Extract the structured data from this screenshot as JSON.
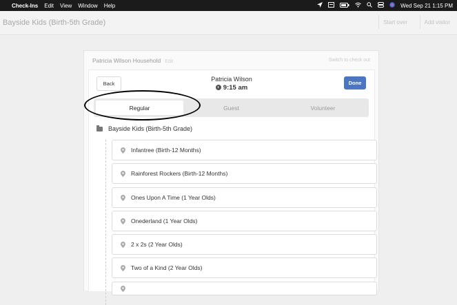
{
  "menubar": {
    "apple_icon": "apple-icon",
    "app_name": "Check-Ins",
    "menus": [
      "Edit",
      "View",
      "Window",
      "Help"
    ],
    "clock": "Wed Sep 21  1:15 PM"
  },
  "header": {
    "title": "Bayside Kids (Birth-5th Grade)",
    "start_over": "Start over",
    "add_visitor": "Add visitor"
  },
  "household": {
    "name": "Patricia Wilson Household",
    "edit": "Edit",
    "switch": "Switch to check out"
  },
  "person": {
    "back": "Back",
    "name": "Patricia Wilson",
    "time": "9:15 am",
    "done": "Done"
  },
  "tabs": [
    "Regular",
    "Guest",
    "Volunteer"
  ],
  "active_tab": "Regular",
  "group": {
    "name": "Bayside Kids (Birth-5th Grade)",
    "locations": [
      "Infantree (Birth-12 Months)",
      "Rainforest Rockers (Birth-12 Months)",
      "Ones Upon A Time (1 Year Olds)",
      "Onederland (1 Year Olds)",
      "2 x 2s (2 Year Olds)",
      "Two of a Kind (2 Year Olds)"
    ]
  },
  "colors": {
    "accent": "#4a76c4",
    "menubar": "#1b1b1b"
  }
}
